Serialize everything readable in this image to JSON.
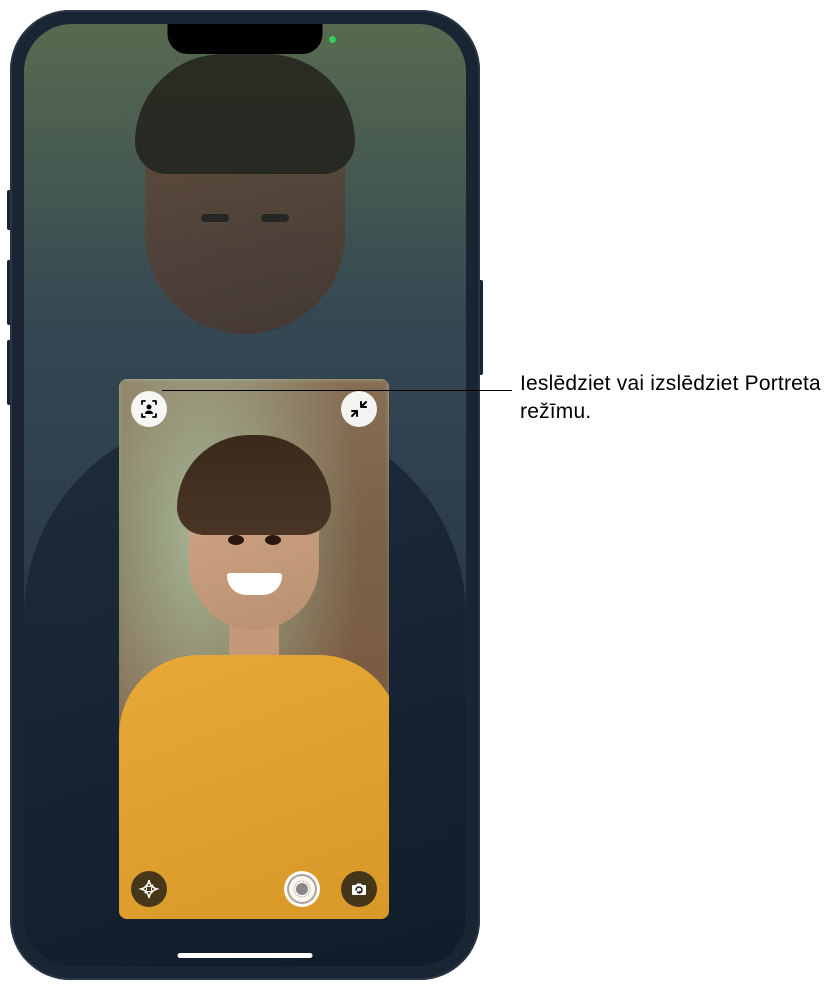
{
  "callout": {
    "portrait_mode": "Ieslēdziet vai izslēdziet Portreta režīmu."
  },
  "controls": {
    "portrait_mode": "portrait-mode",
    "minimize": "minimize",
    "effects": "effects",
    "shutter": "shutter",
    "flip_camera": "flip-camera"
  },
  "ui": {
    "app": "FaceTime",
    "privacy_indicator": "camera-active"
  }
}
